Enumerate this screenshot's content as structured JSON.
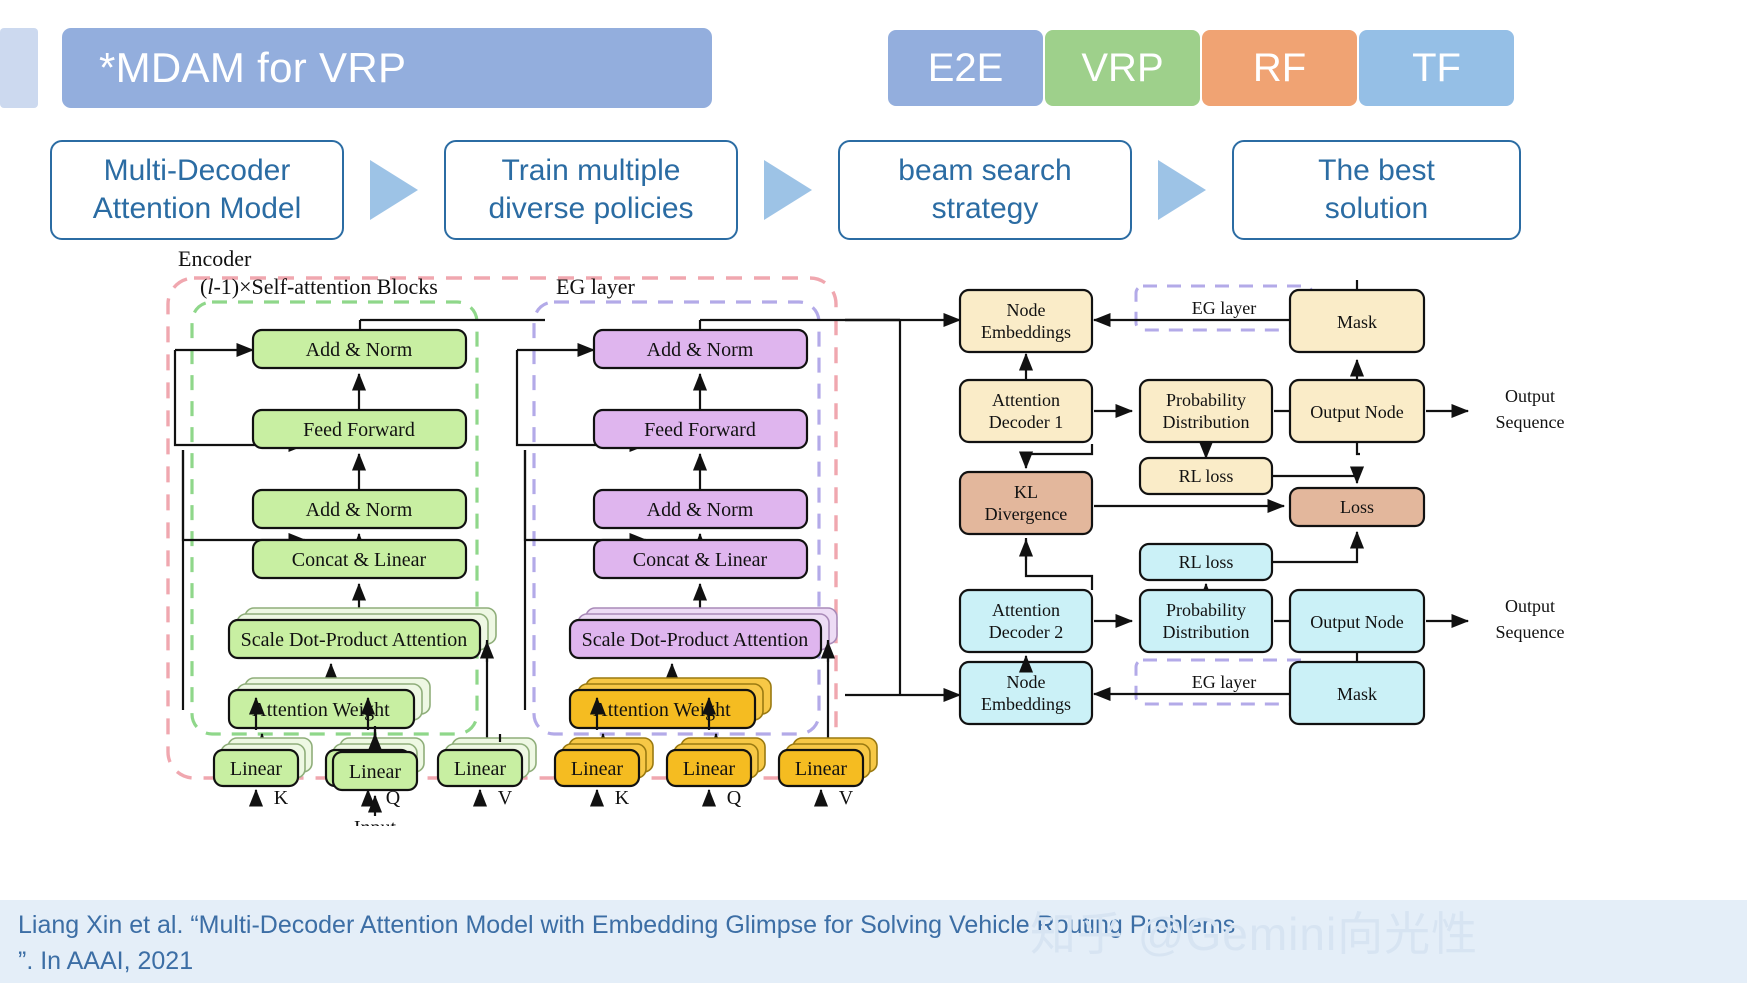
{
  "header": {
    "title": "*MDAM for VRP",
    "chips": [
      {
        "label": "E2E",
        "color": "#93aedd"
      },
      {
        "label": "VRP",
        "color": "#9ed08b"
      },
      {
        "label": "RF",
        "color": "#f0a373"
      },
      {
        "label": "TF",
        "color": "#95bfe6"
      }
    ]
  },
  "flow": {
    "arrow_icon": "triangle-right-icon",
    "steps": [
      {
        "line1": "Multi-Decoder",
        "line2": "Attention Model"
      },
      {
        "line1": "Train multiple",
        "line2": "diverse policies"
      },
      {
        "line1": "beam search",
        "line2": "strategy"
      },
      {
        "line1": "The best",
        "line2": "solution"
      }
    ]
  },
  "diagram": {
    "region_labels": {
      "encoder": "Encoder",
      "self_attention_blocks": "(l-1)×Self-attention Blocks",
      "eg_layer": "EG layer"
    },
    "encoder_left": {
      "blocks": [
        "Add & Norm",
        "Feed Forward",
        "Add & Norm",
        "Concat & Linear",
        "Scale Dot-Product Attention",
        "Attention Weight"
      ],
      "linear": [
        "Linear",
        "Linear",
        "Linear"
      ],
      "kqv": [
        "K",
        "Q",
        "V"
      ]
    },
    "eg_layer_mid": {
      "blocks": [
        "Add & Norm",
        "Feed Forward",
        "Add & Norm",
        "Concat & Linear",
        "Scale Dot-Product Attention"
      ],
      "attention_weight": "Attention Weight",
      "linear": [
        "Linear",
        "Linear",
        "Linear"
      ],
      "kqv": [
        "K",
        "Q",
        "V"
      ]
    },
    "input": {
      "linear": "Linear",
      "label": "Input"
    },
    "decoder_top": {
      "node_embeddings": "Node\nEmbeddings",
      "node_embeddings_l1": "Node",
      "node_embeddings_l2": "Embeddings",
      "eg_layer_tag": "EG layer",
      "mask": "Mask",
      "attention_decoder_l1": "Attention",
      "attention_decoder_l2": "Decoder 1",
      "probability_l1": "Probability",
      "probability_l2": "Distribution",
      "output_node": "Output Node",
      "output_sequence_l1": "Output",
      "output_sequence_l2": "Sequence",
      "rl_loss": "RL loss"
    },
    "decoder_bottom": {
      "node_embeddings_l1": "Node",
      "node_embeddings_l2": "Embeddings",
      "eg_layer_tag": "EG layer",
      "mask": "Mask",
      "attention_decoder_l1": "Attention",
      "attention_decoder_l2": "Decoder 2",
      "probability_l1": "Probability",
      "probability_l2": "Distribution",
      "output_node": "Output Node",
      "output_sequence_l1": "Output",
      "output_sequence_l2": "Sequence",
      "rl_loss": "RL loss"
    },
    "center": {
      "kl_l1": "KL",
      "kl_l2": "Divergence",
      "loss": "Loss"
    }
  },
  "footer": {
    "citation_line1": "Liang Xin et al. “Multi-Decoder Attention Model with Embedding Glimpse for Solving Vehicle Routing Problems",
    "citation_line2": "”. In AAAI, 2021",
    "watermark": "知乎 @Gemini向光性"
  }
}
